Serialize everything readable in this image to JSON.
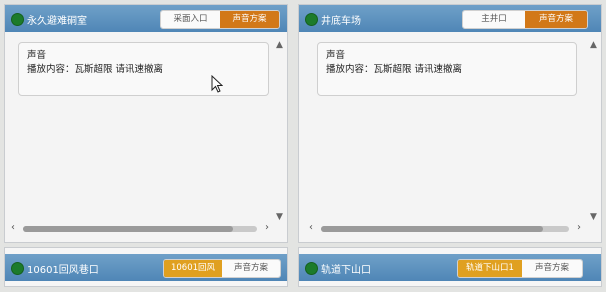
{
  "panels": {
    "top_left": {
      "title": "永久避难硐室",
      "buttons": [
        "采面入口",
        "声音方案"
      ],
      "content_title": "声音",
      "content_text": "播放内容：瓦斯超限 请讯速撤离"
    },
    "top_right": {
      "title": "井底车场",
      "buttons": [
        "主井口",
        "声音方案"
      ],
      "content_title": "声音",
      "content_text": "播放内容：瓦斯超限 请讯速撤离"
    },
    "bottom_left": {
      "title": "10601回风巷口",
      "buttons": [
        "10601回风",
        "声音方案"
      ]
    },
    "bottom_right": {
      "title": "轨道下山口",
      "buttons": [
        "轨道下山口1",
        "声音方案"
      ]
    }
  },
  "colors": {
    "header_blue": "#4f86b6",
    "active_orange": "#d27818",
    "active_yellow": "#e0a020",
    "status_green": "#1c7b2b"
  }
}
